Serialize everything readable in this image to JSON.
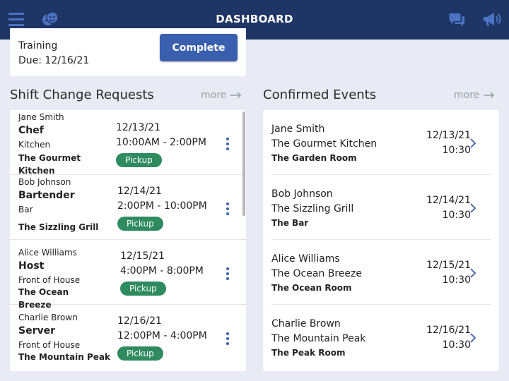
{
  "header": {
    "title": "DASHBOARD"
  },
  "icons": {
    "menu": "menu-icon",
    "faces": "faces-icon",
    "chat": "chat-icon",
    "announcements": "megaphone-icon"
  },
  "colors": {
    "header_bg": "#1f3565",
    "accent": "#3a5fae",
    "pickup": "#2e8a5f"
  },
  "training": {
    "label": "Training",
    "due": "Due: 12/16/21",
    "action": "Complete"
  },
  "shift_section": {
    "title": "Shift Change Requests",
    "more": "more"
  },
  "events_section": {
    "title": "Confirmed Events",
    "more": "more"
  },
  "shifts": [
    {
      "name": "Jane Smith",
      "role": "Chef",
      "dept": "Kitchen",
      "venue": "The Gourmet Kitchen",
      "date": "12/13/21",
      "time": "10:00AM - 2:00PM",
      "status": "Pickup"
    },
    {
      "name": "Bob Johnson",
      "role": "Bartender",
      "dept": "Bar",
      "venue": "The Sizzling Grill",
      "date": "12/14/21",
      "time": "2:00PM - 10:00PM",
      "status": "Pickup"
    },
    {
      "name": "Alice Williams",
      "role": "Host",
      "dept": "Front of House",
      "venue": "The Ocean Breeze",
      "date": "12/15/21",
      "time": "4:00PM - 8:00PM",
      "status": "Pickup"
    },
    {
      "name": "Charlie Brown",
      "role": "Server",
      "dept": "Front of House",
      "venue": "The Mountain Peak",
      "date": "12/16/21",
      "time": "12:00PM - 4:00PM",
      "status": "Pickup"
    }
  ],
  "events": [
    {
      "name": "Jane Smith",
      "venue": "The Gourmet Kitchen",
      "room": "The Garden Room",
      "date": "12/13/21",
      "time": "10:30"
    },
    {
      "name": "Bob Johnson",
      "venue": "The Sizzling Grill",
      "room": "The Bar",
      "date": "12/14/21",
      "time": "10:30"
    },
    {
      "name": "Alice Williams",
      "venue": "The Ocean Breeze",
      "room": "The Ocean Room",
      "date": "12/15/21",
      "time": "10:30"
    },
    {
      "name": "Charlie Brown",
      "venue": "The Mountain Peak",
      "room": "The Peak Room",
      "date": "12/16/21",
      "time": "10:30"
    }
  ]
}
